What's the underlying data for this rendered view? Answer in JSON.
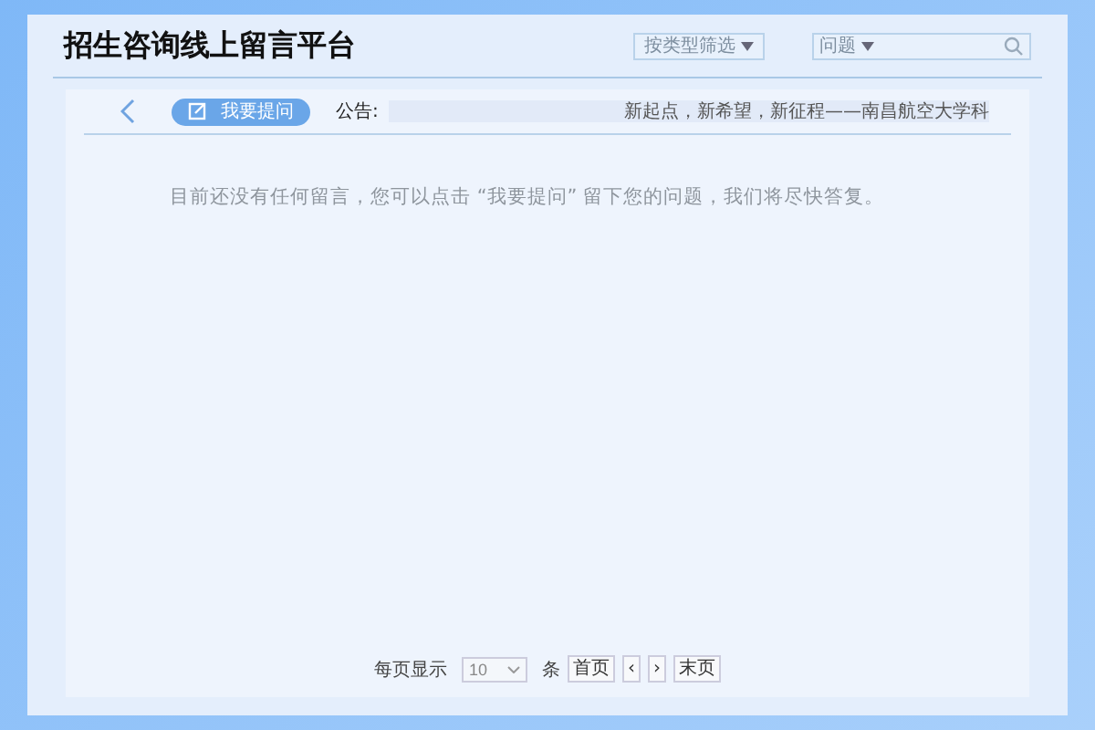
{
  "header": {
    "title": "招生咨询线上留言平台",
    "filter": {
      "label": "按类型筛选"
    },
    "search": {
      "category": "问题"
    }
  },
  "toolbar": {
    "ask_button": "我要提问",
    "notice_label": "公告:",
    "notice_text": "新起点，新希望，新征程——南昌航空大学科"
  },
  "empty_message": "目前还没有任何留言，您可以点击 “我要提问” 留下您的问题，我们将尽快答复。",
  "pagination": {
    "per_page_label": "每页显示",
    "per_page_value": "10",
    "unit": "条",
    "buttons": [
      {
        "label": "首页",
        "disabled": false
      },
      {
        "label": "‹",
        "disabled": false
      },
      {
        "label": "›",
        "disabled": false
      },
      {
        "label": "末页",
        "disabled": false
      }
    ]
  }
}
